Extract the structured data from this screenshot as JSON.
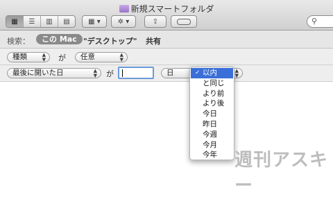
{
  "window": {
    "title": "新規スマートフォルダ"
  },
  "toolbar": {
    "view_buttons": [
      "icon-view",
      "list-view",
      "column-view",
      "coverflow-view"
    ],
    "search_icon": "search-icon"
  },
  "scope": {
    "label": "検索：",
    "selected": "この Mac",
    "options": [
      "\"デスクトップ\"",
      "共有"
    ]
  },
  "rule1": {
    "attribute": "種類",
    "connector": "が",
    "value": "任意"
  },
  "rule2": {
    "attribute": "最後に開いた日",
    "connector": "が",
    "input_value": "",
    "unit": "日"
  },
  "dropdown": {
    "items": [
      {
        "label": "以内",
        "selected": true
      },
      {
        "label": "と同じ"
      },
      {
        "label": "より前"
      },
      {
        "label": "より後"
      },
      {
        "label": "今日"
      },
      {
        "label": "昨日"
      },
      {
        "label": "今週"
      },
      {
        "label": "今月"
      },
      {
        "label": "今年"
      }
    ],
    "check_mark": "✓"
  },
  "watermark": "週刊アスキー"
}
